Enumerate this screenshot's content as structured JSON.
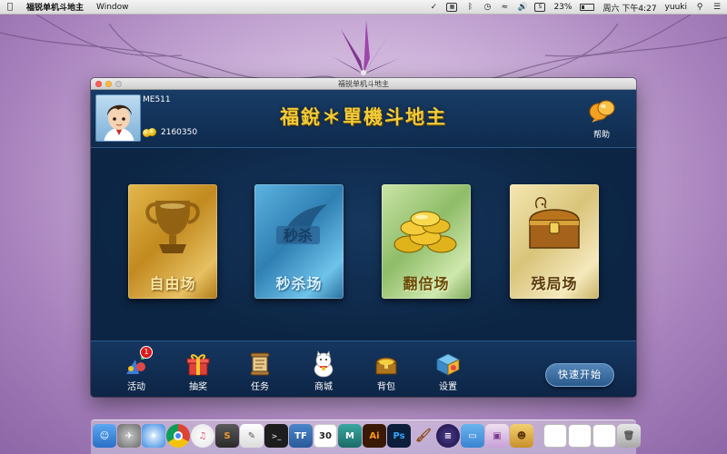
{
  "menubar": {
    "app_name": "福锐单机斗地主",
    "menu_window": "Window",
    "battery_percent": "23%",
    "datetime": "周六 下午4:27",
    "user": "yuuki",
    "battery_level": 0.23
  },
  "window": {
    "title": "福锐单机斗地主"
  },
  "header": {
    "username": "ME511",
    "coins": "2160350",
    "game_title": "福銳＊單機斗地主",
    "help_label": "帮助"
  },
  "modes": [
    {
      "label": "自由场",
      "icon": "trophy-icon"
    },
    {
      "label": "秒杀场",
      "icon": "flash-kill-icon"
    },
    {
      "label": "翻倍场",
      "icon": "gold-coins-icon"
    },
    {
      "label": "残局场",
      "icon": "treasure-chest-icon"
    }
  ],
  "bottom_nav": {
    "activity": {
      "label": "活动",
      "badge": "1"
    },
    "lottery": {
      "label": "抽奖"
    },
    "tasks": {
      "label": "任务"
    },
    "shop": {
      "label": "商城"
    },
    "bag": {
      "label": "背包"
    },
    "settings": {
      "label": "设置"
    },
    "quick_start": "快速开始"
  },
  "dock": {
    "icons": [
      "finder-icon",
      "launchpad-icon",
      "safari-icon",
      "chrome-icon",
      "itunes-icon",
      "sublime-icon",
      "textedit-icon",
      "terminal-icon",
      "tf-icon",
      "calendar-icon",
      "maya-icon",
      "illustrator-icon",
      "photoshop-icon",
      "brush-icon",
      "eclipse-icon",
      "folder-icon",
      "preview-icon",
      "game-icon",
      "finder-window-icon",
      "finder-window-icon-2",
      "finder-window-icon-3",
      "trash-icon"
    ],
    "calendar_day": "30",
    "ai_label": "Ai",
    "ps_label": "Ps"
  }
}
